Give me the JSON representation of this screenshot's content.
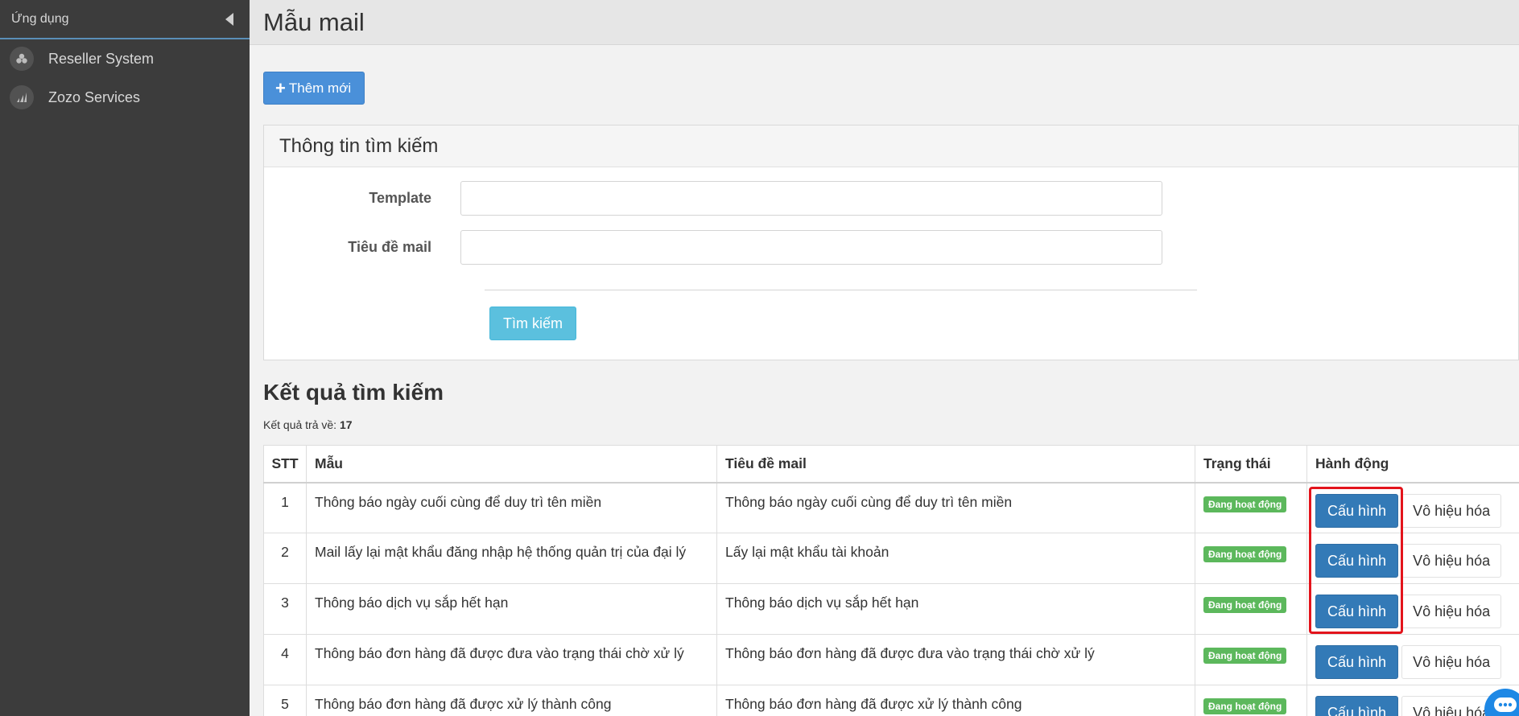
{
  "sidebar": {
    "header": "Ứng dụng",
    "items": [
      {
        "label": "Reseller System",
        "icon": "cluster-icon"
      },
      {
        "label": "Zozo Services",
        "icon": "bars-icon"
      }
    ]
  },
  "page": {
    "title": "Mẫu mail",
    "add_button": "Thêm mới"
  },
  "search": {
    "heading": "Thông tin tìm kiếm",
    "template_label": "Template",
    "template_value": "",
    "subject_label": "Tiêu đề mail",
    "subject_value": "",
    "submit": "Tìm kiếm"
  },
  "results": {
    "title": "Kết quả tìm kiếm",
    "count_label": "Kết quả trả về:",
    "count": "17",
    "columns": [
      "STT",
      "Mẫu",
      "Tiêu đề mail",
      "Trạng thái",
      "Hành động"
    ],
    "config_label": "Cấu hình",
    "disable_label": "Vô hiệu hóa",
    "rows": [
      {
        "stt": "1",
        "template": "Thông báo ngày cuối cùng để duy trì tên miền",
        "subject": "Thông báo ngày cuối cùng để duy trì tên miền",
        "status": "Đang hoạt động"
      },
      {
        "stt": "2",
        "template": "Mail lấy lại mật khẩu đăng nhập hệ thống quản trị của đại lý",
        "subject": "Lấy lại mật khẩu tài khoản",
        "status": "Đang hoạt động"
      },
      {
        "stt": "3",
        "template": "Thông báo dịch vụ sắp hết hạn",
        "subject": "Thông báo dịch vụ sắp hết hạn",
        "status": "Đang hoạt động"
      },
      {
        "stt": "4",
        "template": "Thông báo đơn hàng đã được đưa vào trạng thái chờ xử lý",
        "subject": "Thông báo đơn hàng đã được đưa vào trạng thái chờ xử lý",
        "status": "Đang hoạt động"
      },
      {
        "stt": "5",
        "template": "Thông báo đơn hàng đã được xử lý thành công",
        "subject": "Thông báo đơn hàng đã được xử lý thành công",
        "status": "Đang hoạt động"
      }
    ]
  },
  "colors": {
    "sidebar_bg": "#3c3c3c",
    "primary": "#337ab7",
    "info": "#5bc0de",
    "success": "#5cb85c",
    "highlight": "#e3141c"
  }
}
